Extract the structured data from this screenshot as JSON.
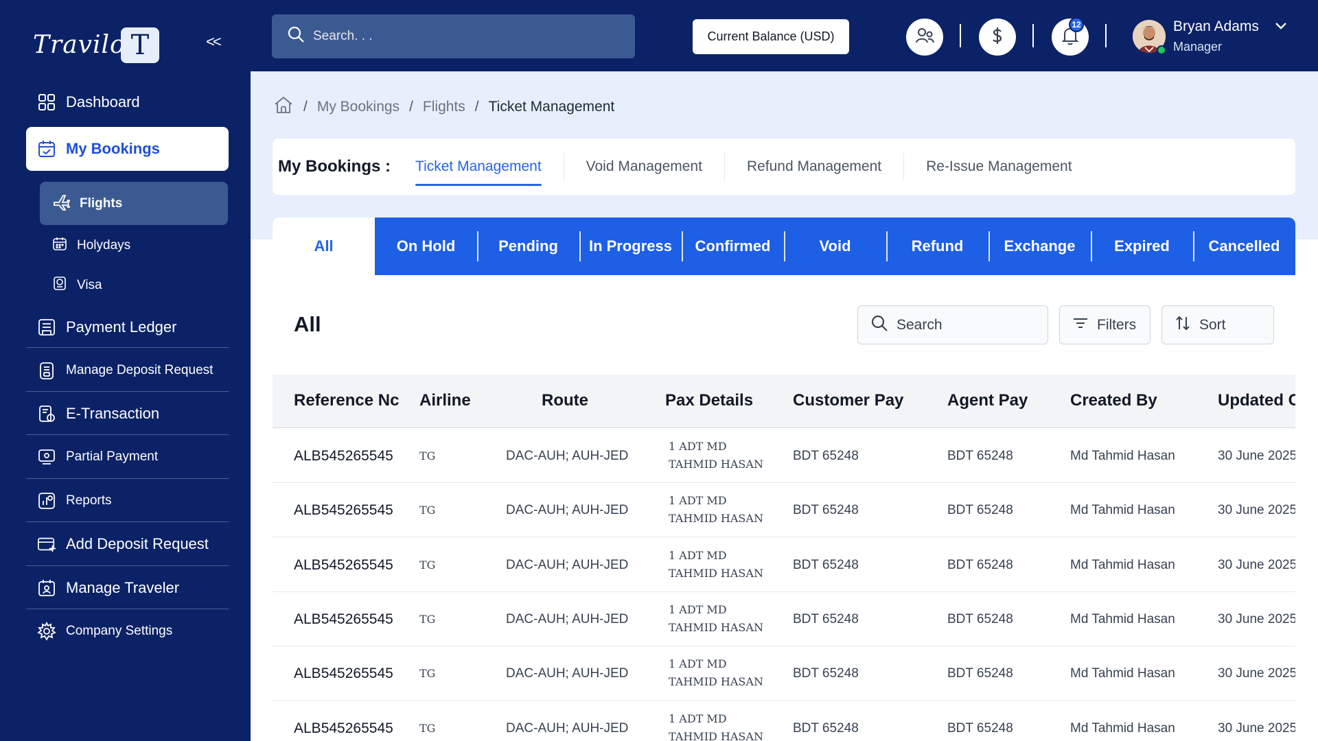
{
  "brand": {
    "logo_text": "Travilo",
    "badge_letter": "T",
    "collapse_label": "<<"
  },
  "sidebar": {
    "items": [
      {
        "label": "Dashboard",
        "icon": "grid-icon"
      },
      {
        "label": "My Bookings",
        "icon": "calendar-check-icon"
      },
      {
        "label": "Flights",
        "icon": "plane-icon"
      },
      {
        "label": "Holydays",
        "icon": "calendar-icon"
      },
      {
        "label": "Visa",
        "icon": "passport-icon"
      },
      {
        "label": "Payment Ledger",
        "icon": "ledger-icon"
      },
      {
        "label": "Manage Deposit Request",
        "icon": "deposit-icon"
      },
      {
        "label": "E-Transaction",
        "icon": "transaction-icon"
      },
      {
        "label": "Partial Payment",
        "icon": "partial-payment-icon"
      },
      {
        "label": "Reports",
        "icon": "reports-icon"
      },
      {
        "label": "Add Deposit Request",
        "icon": "add-deposit-icon"
      },
      {
        "label": "Manage Traveler",
        "icon": "traveler-icon"
      },
      {
        "label": "Company Settings",
        "icon": "gear-icon"
      }
    ]
  },
  "header": {
    "search_placeholder": "Search. . .",
    "balance_label": "Current Balance (USD)",
    "notification_count": "12",
    "user": {
      "name": "Bryan Adams",
      "role": "Manager"
    }
  },
  "breadcrumb": [
    "My Bookings",
    "Flights",
    "Ticket Management"
  ],
  "booking_tabs": {
    "title": "My Bookings :",
    "tabs": [
      "Ticket Management",
      "Void Management",
      "Refund Management",
      "Re-Issue Management"
    ],
    "active": "Ticket Management"
  },
  "status_tabs": [
    "All",
    "On Hold",
    "Pending",
    "In Progress",
    "Confirmed",
    "Void",
    "Refund",
    "Exchange",
    "Expired",
    "Cancelled"
  ],
  "section": {
    "title": "All",
    "search_label": "Search",
    "filters_label": "Filters",
    "sort_label": "Sort"
  },
  "table": {
    "columns": [
      "Reference Nc",
      "Airline",
      "Route",
      "Pax Details",
      "Customer Pay",
      "Agent Pay",
      "Created By",
      "Updated C"
    ],
    "rows": [
      {
        "ref": "ALB545265545",
        "airline": "TG",
        "route": "DAC-AUH; AUH-JED",
        "pax1": "1 ADT MD",
        "pax2": "TAHMID HASAN",
        "customer_pay": "BDT 65248",
        "agent_pay": "BDT 65248",
        "created_by": "Md Tahmid Hasan",
        "updated": "30 June 2025"
      },
      {
        "ref": "ALB545265545",
        "airline": "TG",
        "route": "DAC-AUH; AUH-JED",
        "pax1": "1 ADT MD",
        "pax2": "TAHMID HASAN",
        "customer_pay": "BDT 65248",
        "agent_pay": "BDT 65248",
        "created_by": "Md Tahmid Hasan",
        "updated": "30 June 2025"
      },
      {
        "ref": "ALB545265545",
        "airline": "TG",
        "route": "DAC-AUH; AUH-JED",
        "pax1": "1 ADT MD",
        "pax2": "TAHMID HASAN",
        "customer_pay": "BDT 65248",
        "agent_pay": "BDT 65248",
        "created_by": "Md Tahmid Hasan",
        "updated": "30 June 2025"
      },
      {
        "ref": "ALB545265545",
        "airline": "TG",
        "route": "DAC-AUH; AUH-JED",
        "pax1": "1 ADT MD",
        "pax2": "TAHMID HASAN",
        "customer_pay": "BDT 65248",
        "agent_pay": "BDT 65248",
        "created_by": "Md Tahmid Hasan",
        "updated": "30 June 2025"
      },
      {
        "ref": "ALB545265545",
        "airline": "TG",
        "route": "DAC-AUH; AUH-JED",
        "pax1": "1 ADT MD",
        "pax2": "TAHMID HASAN",
        "customer_pay": "BDT 65248",
        "agent_pay": "BDT 65248",
        "created_by": "Md Tahmid Hasan",
        "updated": "30 June 2025"
      },
      {
        "ref": "ALB545265545",
        "airline": "TG",
        "route": "DAC-AUH; AUH-JED",
        "pax1": "1 ADT MD",
        "pax2": "TAHMID HASAN",
        "customer_pay": "BDT 65248",
        "agent_pay": "BDT 65248",
        "created_by": "Md Tahmid Hasan",
        "updated": "30 June 2025"
      }
    ]
  },
  "colors": {
    "navy": "#0c2266",
    "accent": "#1d5fe5",
    "active_text": "#2563eb",
    "online": "#22c55e"
  }
}
